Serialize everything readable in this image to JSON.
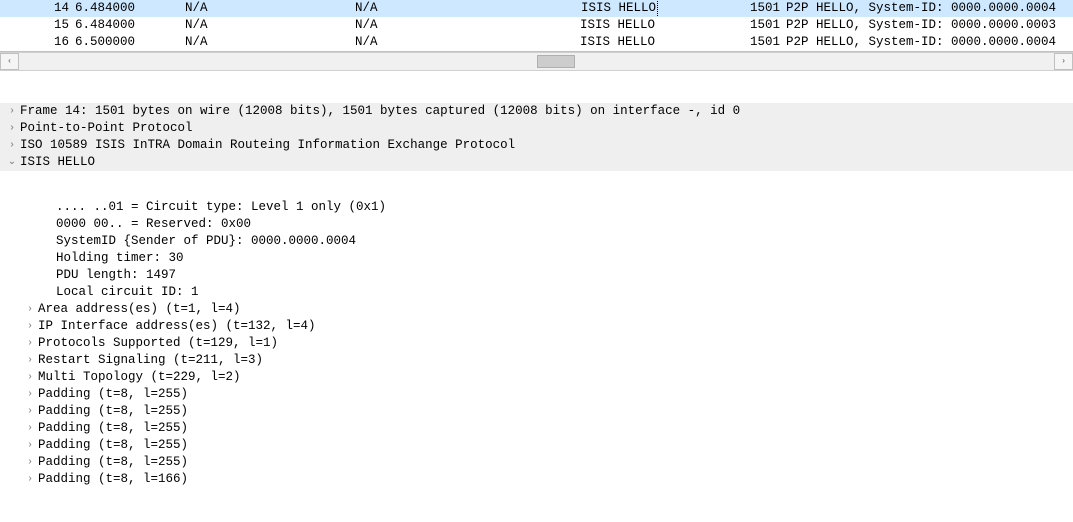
{
  "packet_list": {
    "rows": [
      {
        "no": "14",
        "time": "6.484000",
        "src": "N/A",
        "dst": "N/A",
        "proto": "ISIS HELLO",
        "len": "1501",
        "info": "P2P HELLO, System-ID: 0000.0000.0004",
        "selected": true
      },
      {
        "no": "15",
        "time": "6.484000",
        "src": "N/A",
        "dst": "N/A",
        "proto": "ISIS HELLO",
        "len": "1501",
        "info": "P2P HELLO, System-ID: 0000.0000.0003",
        "selected": false
      },
      {
        "no": "16",
        "time": "6.500000",
        "src": "N/A",
        "dst": "N/A",
        "proto": "ISIS HELLO",
        "len": "1501",
        "info": "P2P HELLO, System-ID: 0000.0000.0004",
        "selected": false
      }
    ]
  },
  "scrollbar": {
    "thumb_left_pct": 50,
    "thumb_width_pct": 3.5,
    "left_glyph": "‹",
    "right_glyph": "›"
  },
  "tree": {
    "header_nodes": [
      {
        "caret": "collapsed",
        "text": "Frame 14: 1501 bytes on wire (12008 bits), 1501 bytes captured (12008 bits) on interface -, id 0"
      },
      {
        "caret": "collapsed",
        "text": "Point-to-Point Protocol"
      },
      {
        "caret": "collapsed",
        "text": "ISO 10589 ISIS InTRA Domain Routeing Information Exchange Protocol"
      },
      {
        "caret": "expanded",
        "text": "ISIS HELLO"
      }
    ],
    "children": [
      {
        "caret": "empty",
        "indent": 2,
        "text": ".... ..01 = Circuit type: Level 1 only (0x1)"
      },
      {
        "caret": "empty",
        "indent": 2,
        "text": "0000 00.. = Reserved: 0x00"
      },
      {
        "caret": "empty",
        "indent": 2,
        "text": "SystemID {Sender of PDU}: 0000.0000.0004"
      },
      {
        "caret": "empty",
        "indent": 2,
        "text": "Holding timer: 30"
      },
      {
        "caret": "empty",
        "indent": 2,
        "text": "PDU length: 1497"
      },
      {
        "caret": "empty",
        "indent": 2,
        "text": "Local circuit ID: 1"
      },
      {
        "caret": "collapsed",
        "indent": 1,
        "text": "Area address(es) (t=1, l=4)"
      },
      {
        "caret": "collapsed",
        "indent": 1,
        "text": "IP Interface address(es) (t=132, l=4)"
      },
      {
        "caret": "collapsed",
        "indent": 1,
        "text": "Protocols Supported (t=129, l=1)"
      },
      {
        "caret": "collapsed",
        "indent": 1,
        "text": "Restart Signaling (t=211, l=3)"
      },
      {
        "caret": "collapsed",
        "indent": 1,
        "text": "Multi Topology (t=229, l=2)"
      },
      {
        "caret": "collapsed",
        "indent": 1,
        "text": "Padding (t=8, l=255)"
      },
      {
        "caret": "collapsed",
        "indent": 1,
        "text": "Padding (t=8, l=255)"
      },
      {
        "caret": "collapsed",
        "indent": 1,
        "text": "Padding (t=8, l=255)"
      },
      {
        "caret": "collapsed",
        "indent": 1,
        "text": "Padding (t=8, l=255)"
      },
      {
        "caret": "collapsed",
        "indent": 1,
        "text": "Padding (t=8, l=255)"
      },
      {
        "caret": "collapsed",
        "indent": 1,
        "text": "Padding (t=8, l=166)"
      }
    ]
  }
}
